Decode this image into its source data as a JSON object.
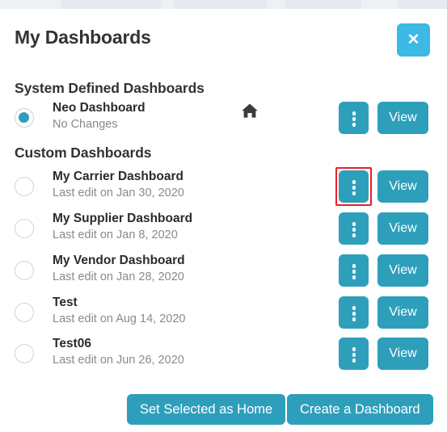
{
  "modal": {
    "title": "My Dashboards",
    "close_label": "✕"
  },
  "sections": {
    "system": {
      "header": "System Defined Dashboards",
      "rows": [
        {
          "title": "Neo Dashboard",
          "subtitle": "No Changes",
          "selected": true,
          "is_home": true,
          "menu_label": "kebab-menu",
          "view_label": "View"
        }
      ]
    },
    "custom": {
      "header": "Custom Dashboards",
      "rows": [
        {
          "title": "My Carrier Dashboard",
          "subtitle": "Last edit on Jan 30, 2020",
          "selected": false,
          "is_home": false,
          "menu_label": "kebab-menu",
          "view_label": "View",
          "highlighted": true
        },
        {
          "title": "My Supplier Dashboard",
          "subtitle": "Last edit on Jan 8, 2020",
          "selected": false,
          "is_home": false,
          "menu_label": "kebab-menu",
          "view_label": "View"
        },
        {
          "title": "My Vendor Dashboard",
          "subtitle": "Last edit on Jan 28, 2020",
          "selected": false,
          "is_home": false,
          "menu_label": "kebab-menu",
          "view_label": "View"
        },
        {
          "title": "Test",
          "subtitle": "Last edit on Aug 14, 2020",
          "selected": false,
          "is_home": false,
          "menu_label": "kebab-menu",
          "view_label": "View"
        },
        {
          "title": "Test06",
          "subtitle": "Last edit on Jun 26, 2020",
          "selected": false,
          "is_home": false,
          "menu_label": "kebab-menu",
          "view_label": "View"
        }
      ]
    }
  },
  "footer": {
    "set_home_label": "Set Selected as Home",
    "create_label": "Create a Dashboard"
  },
  "colors": {
    "teal": "#2e9fbb",
    "sky": "#3cb9e5",
    "radio_fill": "#2e9fc0",
    "annotation": "#ee1d24",
    "title_text": "#333333",
    "subtitle_text": "#8a8a8a"
  }
}
